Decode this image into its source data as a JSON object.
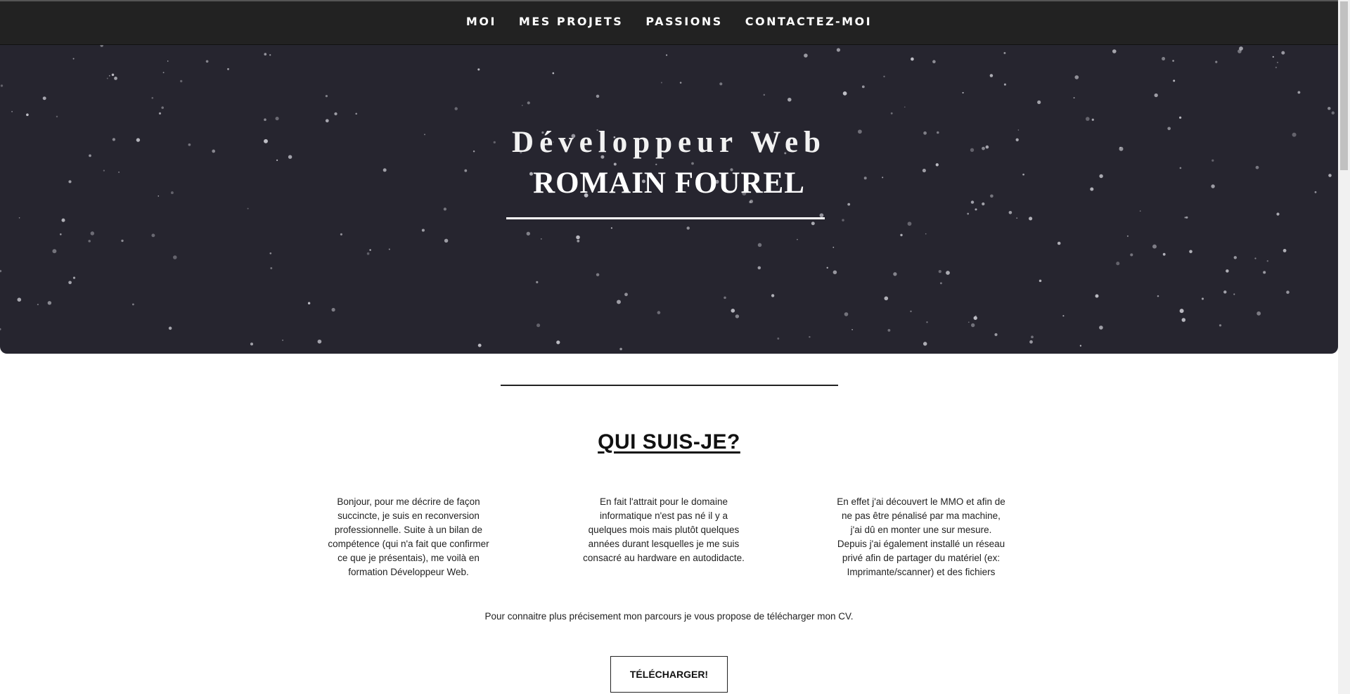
{
  "nav": {
    "items": [
      {
        "label": "MOI"
      },
      {
        "label": "MES PROJETS"
      },
      {
        "label": "PASSIONS"
      },
      {
        "label": "CONTACTEZ-MOI"
      }
    ]
  },
  "hero": {
    "title": "Développeur Web",
    "name": "ROMAIN FOUREL"
  },
  "about": {
    "title": "QUI SUIS-JE?",
    "columns": [
      "Bonjour, pour me décrire de façon succincte, je suis en reconversion professionnelle. Suite à un bilan de compétence (qui n'a fait que confirmer ce que je présentais), me voilà en formation Développeur Web.",
      "En fait l'attrait pour le domaine informatique n'est pas né il y a quelques mois mais plutôt quelques années durant lesquelles je me suis consacré au hardware en autodidacte.",
      "En effet j'ai découvert le MMO et afin de ne pas être pénalisé par ma machine, j'ai dû en monter une sur mesure. Depuis j'ai également installé un réseau privé afin de partager du matériel (ex: Imprimante/scanner) et des fichiers"
    ],
    "cv_text": "Pour connaitre plus précisement mon parcours je vous propose de télécharger mon CV.",
    "download_label": "TÉLÉCHARGER!"
  },
  "colors": {
    "navbar": "#222222",
    "hero_bg": "#26252f",
    "text": "#1a1a1a"
  }
}
